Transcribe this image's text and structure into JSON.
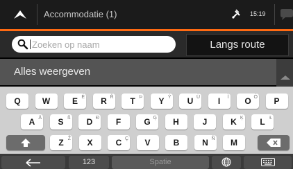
{
  "header": {
    "title": "Accommodatie (1)",
    "clock": "15:19"
  },
  "search": {
    "placeholder": "Zoeken op naam",
    "route_button": "Langs route"
  },
  "list": {
    "items": [
      {
        "label": "Alles weergeven"
      }
    ]
  },
  "keyboard": {
    "row1": [
      {
        "k": "Q",
        "s": ""
      },
      {
        "k": "W",
        "s": ""
      },
      {
        "k": "E",
        "s": "É"
      },
      {
        "k": "R",
        "s": "Ř"
      },
      {
        "k": "T",
        "s": "Þ"
      },
      {
        "k": "Y",
        "s": "Ý"
      },
      {
        "k": "U",
        "s": "Ü"
      },
      {
        "k": "I",
        "s": "Ì"
      },
      {
        "k": "O",
        "s": "Ö"
      },
      {
        "k": "P",
        "s": ""
      }
    ],
    "row2": [
      {
        "k": "A",
        "s": "Ä"
      },
      {
        "k": "S",
        "s": "ß"
      },
      {
        "k": "D",
        "s": "Ð"
      },
      {
        "k": "F",
        "s": ""
      },
      {
        "k": "G",
        "s": "Ģ"
      },
      {
        "k": "H",
        "s": ""
      },
      {
        "k": "J",
        "s": ""
      },
      {
        "k": "K",
        "s": "Ķ"
      },
      {
        "k": "L",
        "s": "Ł"
      }
    ],
    "row3": [
      {
        "k": "Z",
        "s": "Ž"
      },
      {
        "k": "X",
        "s": ""
      },
      {
        "k": "C",
        "s": "Ç"
      },
      {
        "k": "V",
        "s": ""
      },
      {
        "k": "B",
        "s": ""
      },
      {
        "k": "N",
        "s": "Ñ"
      },
      {
        "k": "M",
        "s": ""
      }
    ],
    "numbers_label": "123",
    "space_label": "Spatie"
  },
  "icons": {
    "back": "up-arrow-icon",
    "gps": "gps-satellite-icon",
    "messages": "speech-bubble-icon",
    "search": "magnifier-icon",
    "scroll": "scroll-up-icon",
    "shift": "shift-icon",
    "backspace": "backspace-icon",
    "hide_keyboard": "left-arrow-icon",
    "language": "globe-icon",
    "keyboard_switch": "keyboard-icon"
  },
  "colors": {
    "accent": "#ff6a12",
    "titlebar_bg": "#1b1b1b",
    "list_row_bg": "#545454",
    "keyboard_bg": "#cfcfcf"
  }
}
